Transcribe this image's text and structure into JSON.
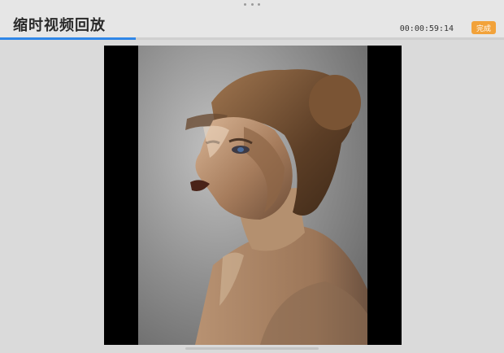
{
  "header": {
    "title": "缩时视频回放",
    "timecode": "00:00:59:14",
    "done_label": "完成"
  },
  "playback": {
    "progress": 0.27
  },
  "colors": {
    "accent": "#2f86e8",
    "done_button": "#f2a23a",
    "letterbox": "#000000"
  },
  "icons": {
    "grabber": "drag-handle-dots"
  }
}
